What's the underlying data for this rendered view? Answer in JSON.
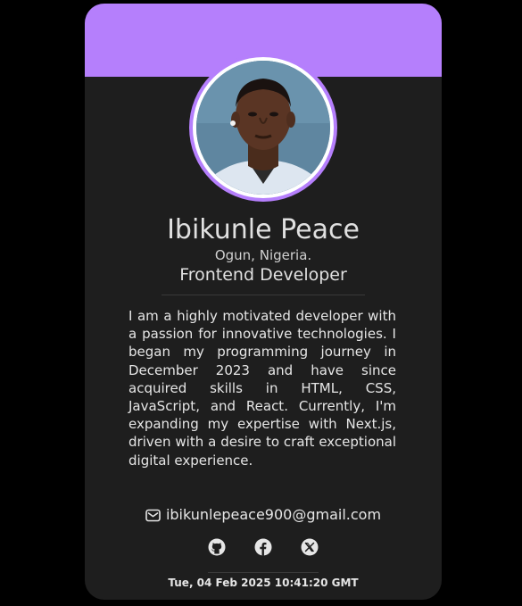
{
  "profile": {
    "name": "Ibikunle Peace",
    "location": "Ogun, Nigeria.",
    "role": "Frontend Developer",
    "bio": "I am a highly motivated developer with a passion for innovative technologies. I began my programming journey in December 2023 and have since acquired skills in HTML, CSS, JavaScript, and React. Currently, I'm expanding my expertise with Next.js, driven with a desire to craft exceptional digital experience.",
    "email": "ibikunlepeace900@gmail.com",
    "email_icon": "envelope-icon"
  },
  "socials": [
    {
      "icon": "github-icon"
    },
    {
      "icon": "facebook-icon"
    },
    {
      "icon": "x-twitter-icon"
    }
  ],
  "footer": {
    "timestamp": "Tue, 04 Feb 2025 10:41:20 GMT"
  },
  "colors": {
    "page_background": "#000000",
    "card_background": "#1e1e1e",
    "accent": "#b57ffc",
    "text": "#e6e6e6"
  }
}
